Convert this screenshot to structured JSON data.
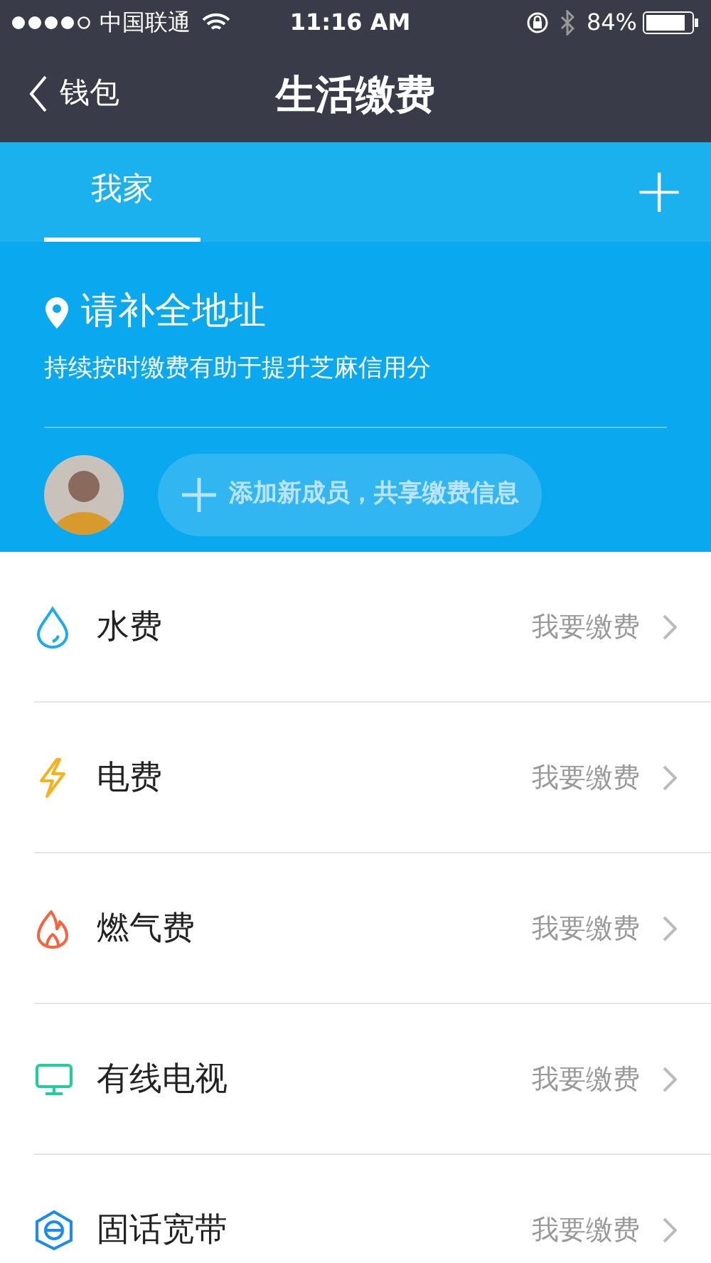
{
  "status_bar": {
    "carrier": "中国联通",
    "time": "11:16 AM",
    "battery": "84%"
  },
  "nav": {
    "back": "钱包",
    "title": "生活缴费"
  },
  "tabs": [
    {
      "label": "我家",
      "selected": true
    }
  ],
  "add_button": "+",
  "address": {
    "title": "请补全地址",
    "subtitle": "持续按时缴费有助于提升芝麻信用分"
  },
  "members": {
    "add_label": "添加新成员，共享缴费信息"
  },
  "services": [
    {
      "kind": "water",
      "name": "水费",
      "action": "我要缴费"
    },
    {
      "kind": "power",
      "name": "电费",
      "action": "我要缴费"
    },
    {
      "kind": "gas",
      "name": "燃气费",
      "action": "我要缴费"
    },
    {
      "kind": "tv",
      "name": "有线电视",
      "action": "我要缴费"
    },
    {
      "kind": "phone",
      "name": "固话宽带",
      "action": "我要缴费"
    }
  ]
}
